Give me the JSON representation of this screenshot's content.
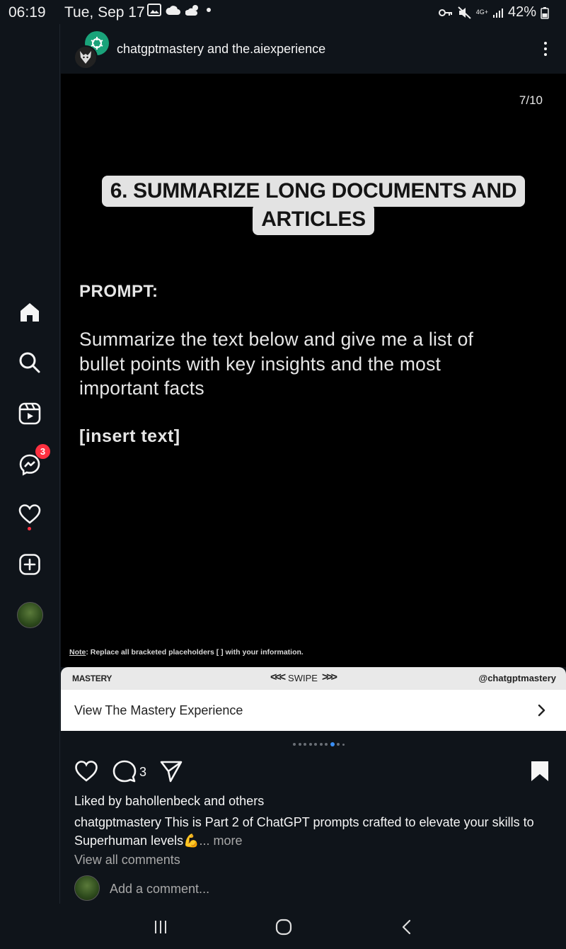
{
  "status_bar": {
    "time": "06:19",
    "date": "Tue, Sep 17",
    "battery": "42%",
    "network": "4G+"
  },
  "sidebar": {
    "items": [
      {
        "label": "Home",
        "icon": "home-icon"
      },
      {
        "label": "Search",
        "icon": "search-icon"
      },
      {
        "label": "Reels",
        "icon": "reels-icon"
      },
      {
        "label": "Messages",
        "icon": "messenger-icon",
        "badge": "3"
      },
      {
        "label": "Notifications",
        "icon": "heart-icon"
      },
      {
        "label": "Create",
        "icon": "plus-square-icon"
      },
      {
        "label": "Profile",
        "icon": "avatar"
      }
    ]
  },
  "post": {
    "usernames": "chatgptmastery and the.aiexperience",
    "slide": {
      "counter": "7/10",
      "title_line1": "6. SUMMARIZE LONG DOCUMENTS AND",
      "title_line2": "ARTICLES",
      "prompt_label": "PROMPT:",
      "prompt_line1": "Summarize the text below and give me a list of",
      "prompt_line2": "bullet points with key insights and the most",
      "prompt_line3": "important facts",
      "insert": "[insert text]",
      "note_label": "Note",
      "note_text": ": Replace all bracketed placeholders [ ] with your information.",
      "footer_left": "MASTERY",
      "footer_mid": "SWIPE",
      "footer_right": "@chatgptmastery"
    },
    "cta": "View The Mastery Experience",
    "carousel": {
      "total": 10,
      "current": 7
    },
    "comment_count": "3",
    "liked_by": "Liked by bahollenbeck and others",
    "caption_user": "chatgptmastery",
    "caption_text": " This is Part 2 of ChatGPT prompts crafted to elevate your skills to Superhuman levels💪",
    "caption_more": "... more",
    "view_comments": "View all comments",
    "comment_placeholder": "Add a comment..."
  },
  "colors": {
    "accent": "#3a8ff5",
    "badge": "#ff3040",
    "background": "#0f141a"
  }
}
